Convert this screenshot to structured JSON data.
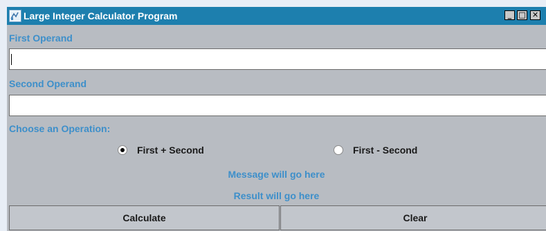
{
  "window": {
    "title": "Large Integer Calculator Program",
    "minimize": "_",
    "maximize": "□",
    "close": "✕"
  },
  "first_operand": {
    "label": "First Operand",
    "value": ""
  },
  "second_operand": {
    "label": "Second Operand",
    "value": ""
  },
  "operation": {
    "label": "Choose an Operation:",
    "options": [
      {
        "label": "First + Second",
        "selected": true
      },
      {
        "label": "First - Second",
        "selected": false
      }
    ]
  },
  "message": "Message will go here",
  "result": "Result will go here",
  "buttons": {
    "calculate": "Calculate",
    "clear": "Clear"
  },
  "colors": {
    "titlebar": "#1d7fae",
    "label": "#3d8fca",
    "panel": "#b8bcc2"
  },
  "icons": {
    "app": "calculator-app-icon"
  }
}
